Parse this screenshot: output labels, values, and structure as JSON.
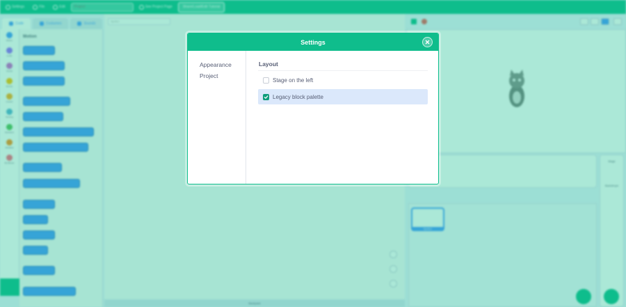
{
  "editor": {
    "menu": {
      "settings_label": "Settings",
      "file_label": "File",
      "edit_label": "Edit",
      "project_title_placeholder": "Project",
      "project_page_label": "See Project Page",
      "share_label": "Share/Load/Edit Tutorial"
    },
    "tabs": {
      "code": "Code",
      "costumes": "Costumes",
      "sounds": "Sounds"
    },
    "categories": [
      {
        "label": "Motion",
        "color": "#4c97ff"
      },
      {
        "label": "Looks",
        "color": "#9966ff"
      },
      {
        "label": "Sound",
        "color": "#cf63cf"
      },
      {
        "label": "Events",
        "color": "#ffbf00"
      },
      {
        "label": "Control",
        "color": "#ffab19"
      },
      {
        "label": "Sensing",
        "color": "#5cb1d6"
      },
      {
        "label": "Operators",
        "color": "#59c059"
      },
      {
        "label": "Variables",
        "color": "#ff8c1a"
      },
      {
        "label": "My Blocks",
        "color": "#ff6680"
      }
    ],
    "palette_title": "Motion",
    "sprite_name_placeholder": "Sprite1",
    "backpack_label": "Backpack",
    "stage_target_label": "Stage",
    "backdrops_label": "Backdrops",
    "sprite_thumb_label": "Sprite1"
  },
  "settings_modal": {
    "title": "Settings",
    "nav": [
      {
        "label": "Appearance"
      },
      {
        "label": "Project"
      }
    ],
    "section_title": "Layout",
    "options": [
      {
        "label": "Stage on the left",
        "checked": false
      },
      {
        "label": "Legacy block palette",
        "checked": true
      }
    ]
  }
}
